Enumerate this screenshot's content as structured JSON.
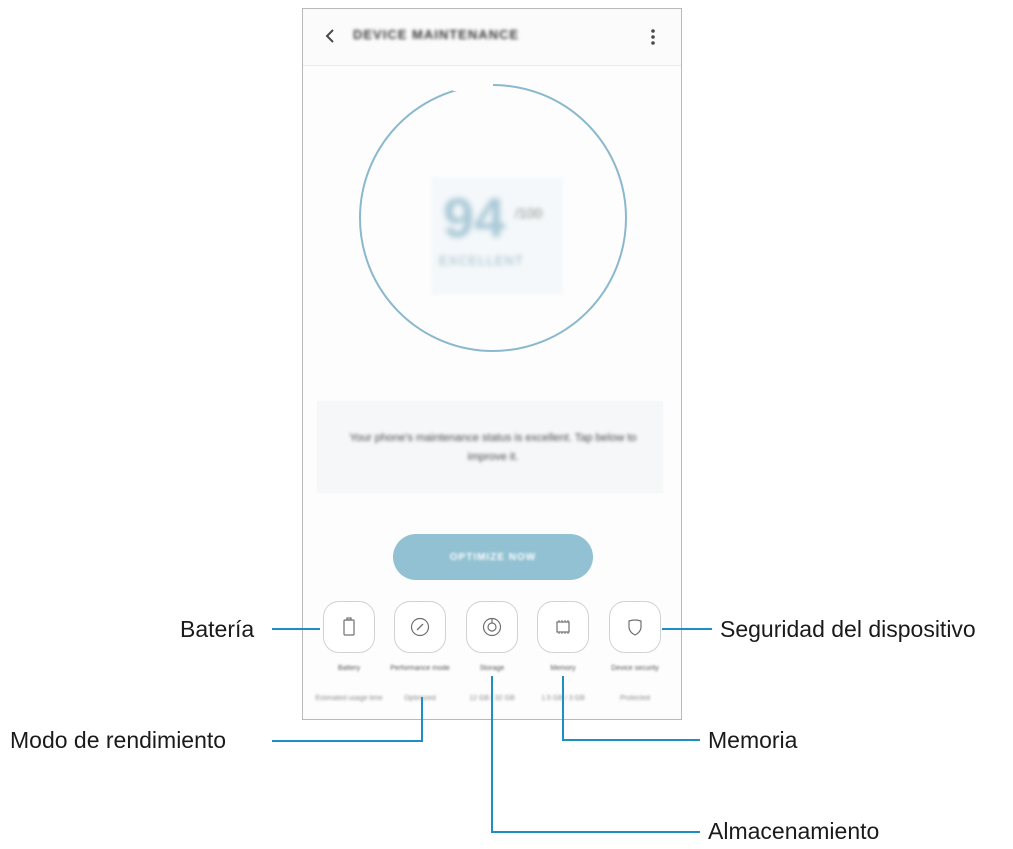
{
  "appbar": {
    "title": "DEVICE MAINTENANCE",
    "back_icon": "chevron-left-icon",
    "more_icon": "more-vert-icon"
  },
  "score": {
    "value": "94",
    "unit": "/100",
    "label": "EXCELLENT"
  },
  "status": {
    "text": "Your phone's maintenance status is excellent. Tap below to improve it."
  },
  "optimize_button": {
    "label": "OPTIMIZE NOW"
  },
  "tiles": [
    {
      "label": "Battery",
      "sub": "Estimated usage time",
      "icon": "battery-icon"
    },
    {
      "label": "Performance mode",
      "sub": "Optimized",
      "icon": "speedometer-icon"
    },
    {
      "label": "Storage",
      "sub": "12 GB / 32 GB",
      "icon": "storage-disc-icon"
    },
    {
      "label": "Memory",
      "sub": "1.5 GB / 3 GB",
      "icon": "memory-chip-icon"
    },
    {
      "label": "Device security",
      "sub": "Protected",
      "icon": "shield-icon"
    }
  ],
  "callouts": {
    "bateria": "Batería",
    "modo": "Modo de rendimiento",
    "almacenamiento": "Almacenamiento",
    "memoria": "Memoria",
    "seguridad": "Seguridad del dispositivo"
  },
  "colors": {
    "accent": "#91c1d2",
    "ring": "#8ab8cd",
    "callout_line": "#1f8fc3"
  }
}
